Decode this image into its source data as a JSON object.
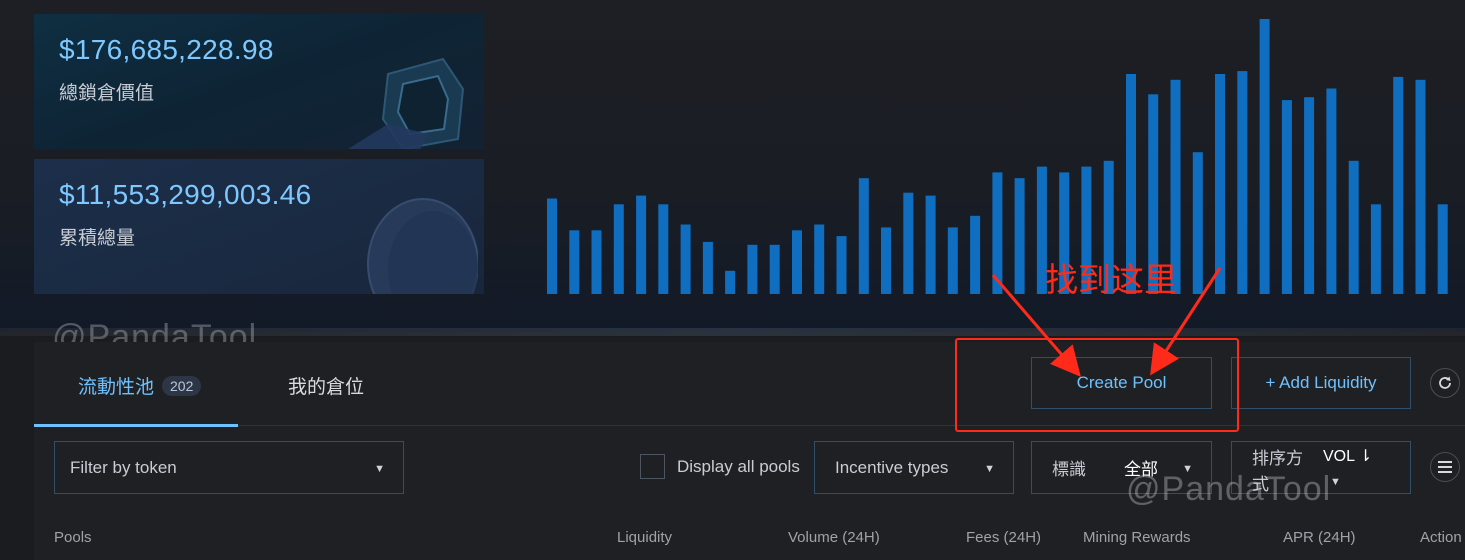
{
  "stats": {
    "tvl_value": "$176,685,228.98",
    "tvl_label": "總鎖倉價值",
    "volume_value": "$11,553,299,003.46",
    "volume_label": "累積總量"
  },
  "chart_data": {
    "type": "bar",
    "values": [
      33,
      22,
      22,
      31,
      34,
      31,
      24,
      18,
      8,
      17,
      17,
      22,
      24,
      20,
      40,
      23,
      35,
      34,
      23,
      27,
      42,
      40,
      44,
      42,
      44,
      46,
      76,
      69,
      74,
      49,
      76,
      77,
      95,
      67,
      68,
      71,
      46,
      31,
      75,
      74,
      31
    ],
    "color": "#0f6ebf"
  },
  "watermark": "@PandaTool",
  "tabs": [
    {
      "label": "流動性池",
      "badge": "202"
    },
    {
      "label": "我的倉位"
    }
  ],
  "buttons": {
    "create_pool": "Create Pool",
    "add_liquidity": "+ Add Liquidity"
  },
  "icons": {
    "refresh": "refresh-icon",
    "menu": "menu-icon",
    "caret": "caret-down-icon"
  },
  "filters": {
    "token_placeholder": "Filter by token",
    "display_all": "Display all pools",
    "incentive": "Incentive types",
    "tag_label": "標識",
    "tag_value": "全部",
    "sort_label": "排序方式",
    "sort_value": "VOL ⇂"
  },
  "table": {
    "columns": [
      "Pools",
      "Liquidity",
      "Volume (24H)",
      "Fees (24H)",
      "Mining Rewards",
      "APR (24H)",
      "Action"
    ]
  },
  "annotation": {
    "text": "找到这里",
    "color": "#ff2a1a"
  }
}
